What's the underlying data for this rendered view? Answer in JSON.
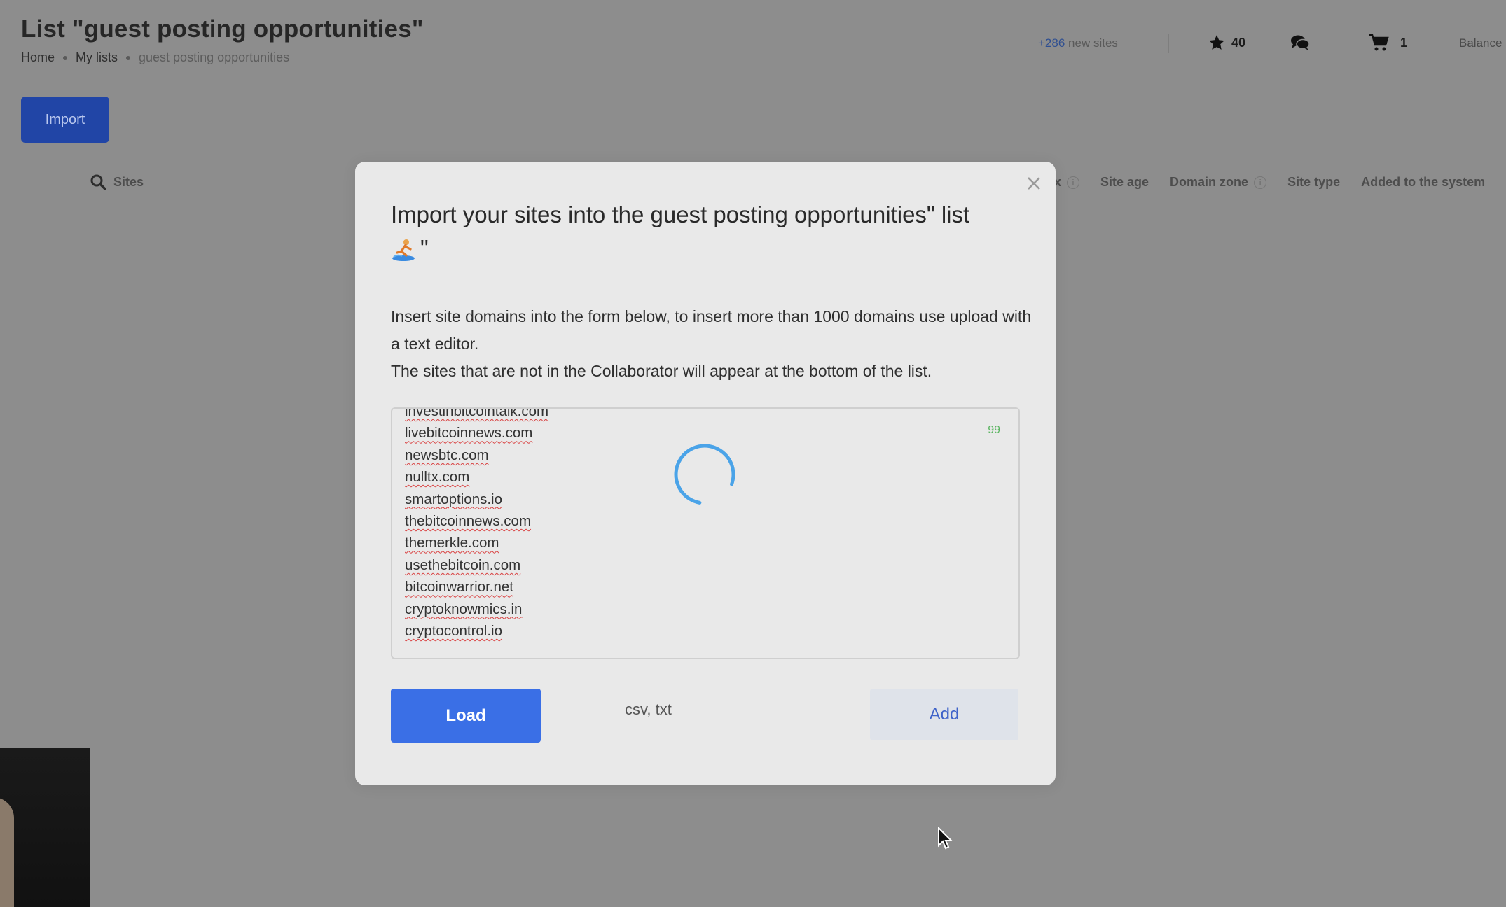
{
  "page": {
    "title": "List \"guest posting opportunities\"",
    "breadcrumb": [
      "Home",
      "My lists",
      "guest posting opportunities"
    ]
  },
  "header": {
    "new_sites_count": "+286",
    "new_sites_label": "new sites",
    "favorites_count": "40",
    "cart_count": "1",
    "balance_label": "Balance"
  },
  "toolbar": {
    "import_label": "Import"
  },
  "filter": {
    "sites_label": "Sites",
    "icon": "search-icon"
  },
  "table": {
    "columns": [
      "x",
      "Site age",
      "Domain zone",
      "Site type",
      "Added to the system"
    ]
  },
  "modal": {
    "title": "Import your sites into the guest posting opportunities\" list",
    "title_suffix": "\"",
    "description_1": "Insert site domains into the form below, to insert more than 1000 domains use upload with a text editor.",
    "description_2": "The sites that are not in the Collaborator will appear at the bottom of the list.",
    "domains": [
      "investinbitcointalk.com",
      "livebitcoinnews.com",
      "newsbtc.com",
      "nulltx.com",
      "smartoptions.io",
      "thebitcoinnews.com",
      "themerkle.com",
      "usethebitcoin.com",
      "bitcoinwarrior.net",
      "cryptoknowmics.in",
      "cryptocontrol.io"
    ],
    "domain_count": "99",
    "load_label": "Load",
    "file_types": "csv, txt",
    "add_label": "Add"
  },
  "colors": {
    "primary": "#3a6fe6",
    "overlay": "#8d8d8d",
    "spinner": "#4aa3e8",
    "count_green": "#58b45e"
  }
}
